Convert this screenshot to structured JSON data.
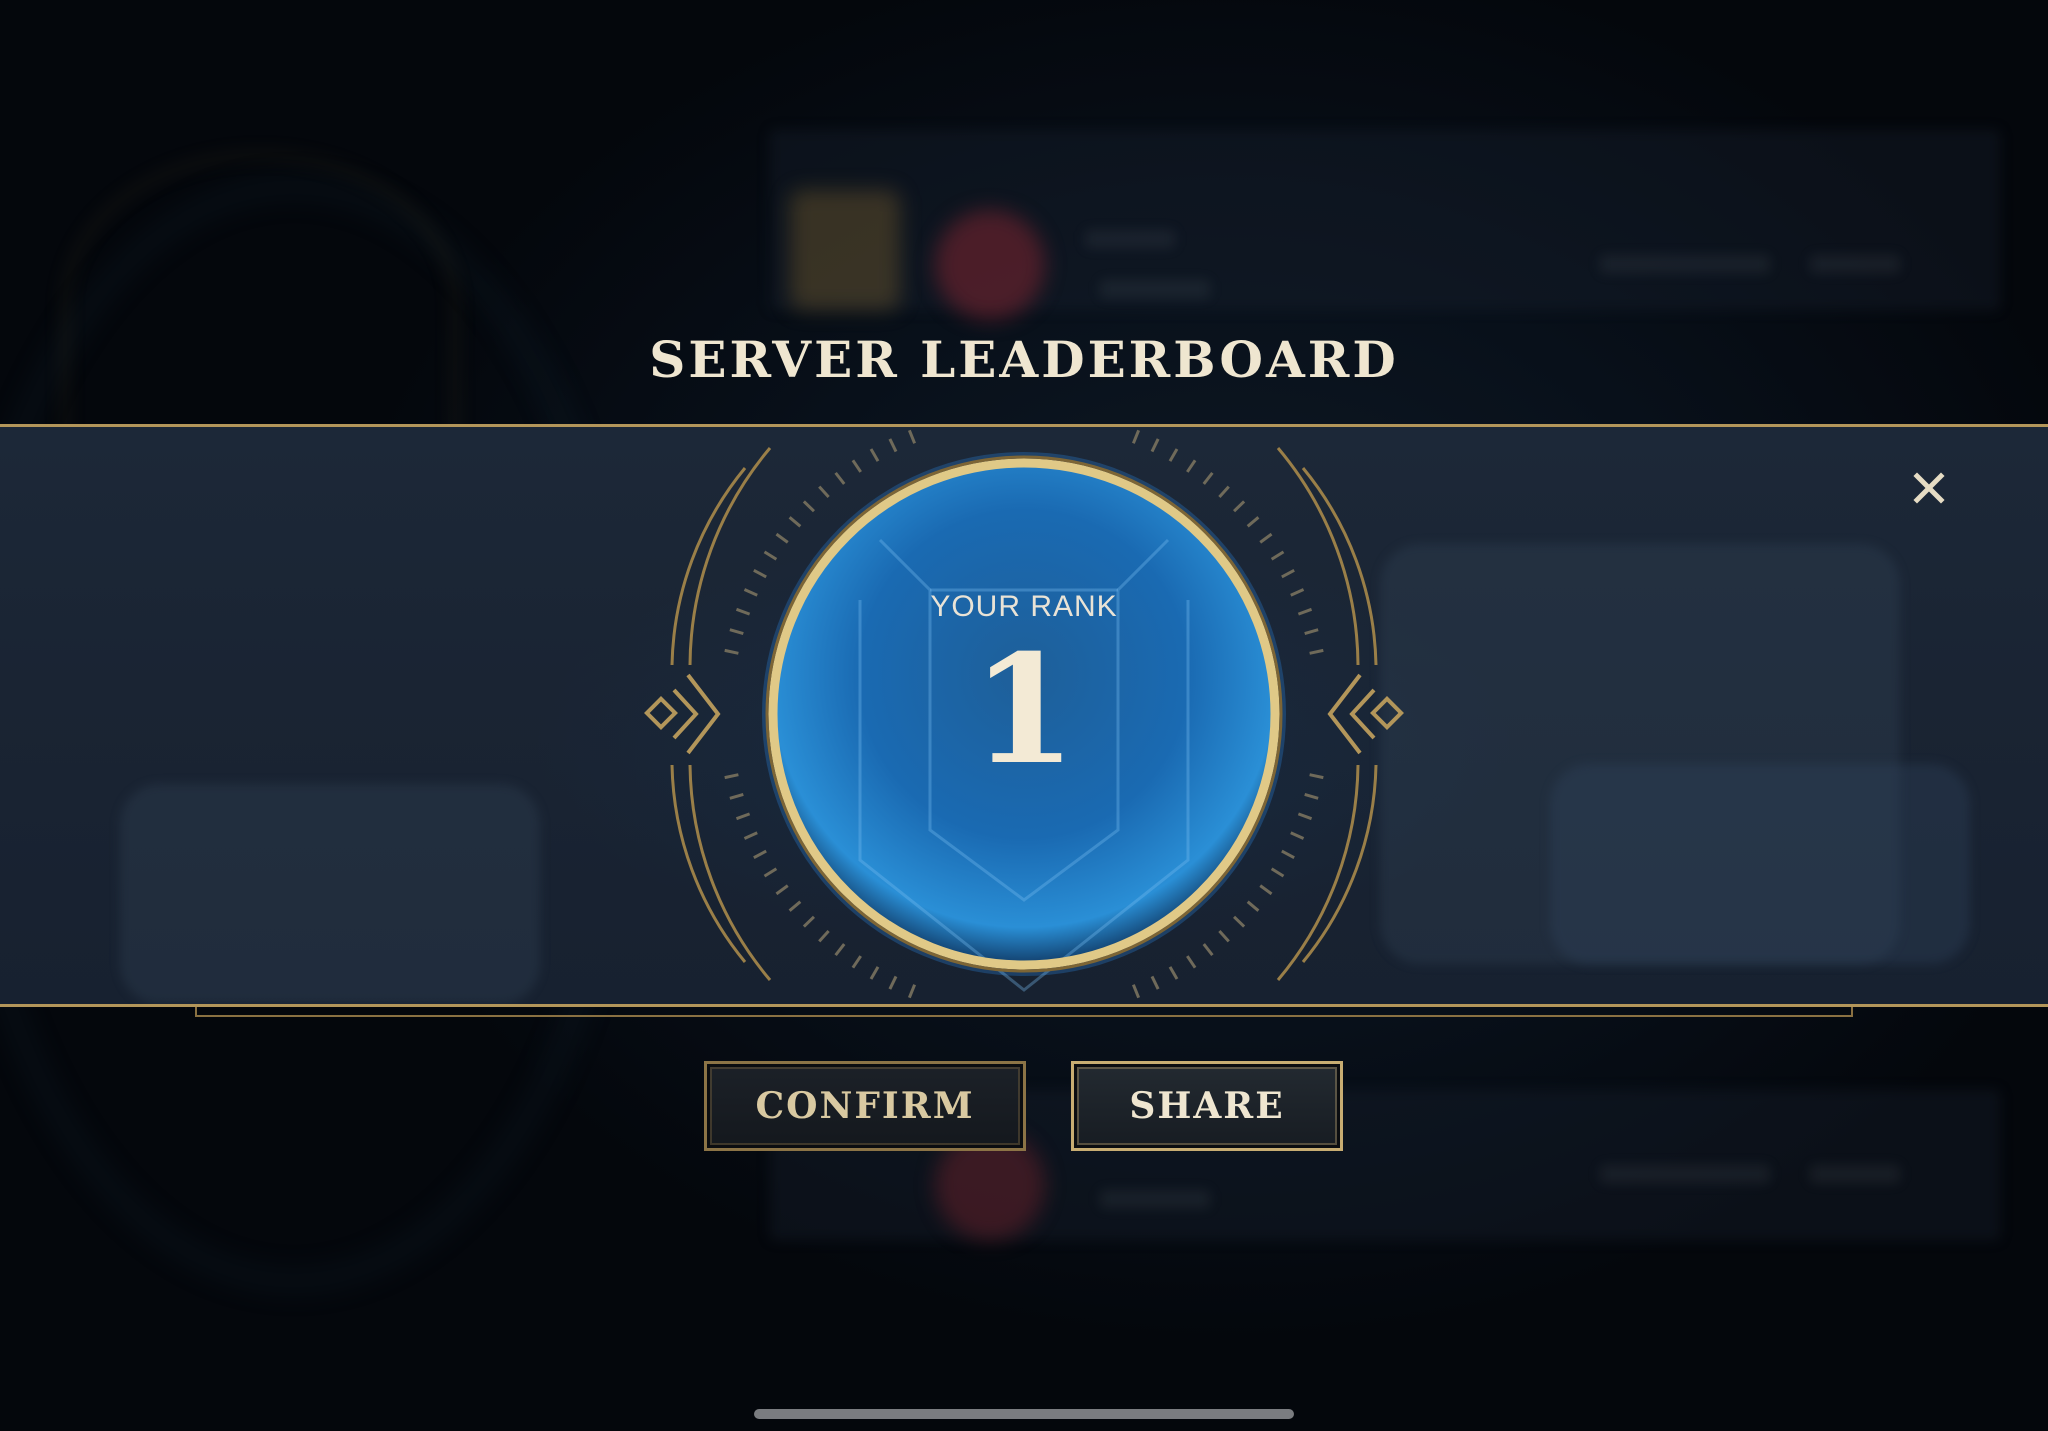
{
  "dialog": {
    "title": "SERVER LEADERBOARD",
    "rank_label": "YOUR RANK",
    "rank_value": "1",
    "close_icon": "close-icon"
  },
  "buttons": {
    "confirm_label": "CONFIRM",
    "share_label": "SHARE"
  },
  "colors": {
    "gold": "#b3965a",
    "title_text": "#efe6d0",
    "orb_blue": "#1d6fb8",
    "band_background": "#1a2433"
  }
}
